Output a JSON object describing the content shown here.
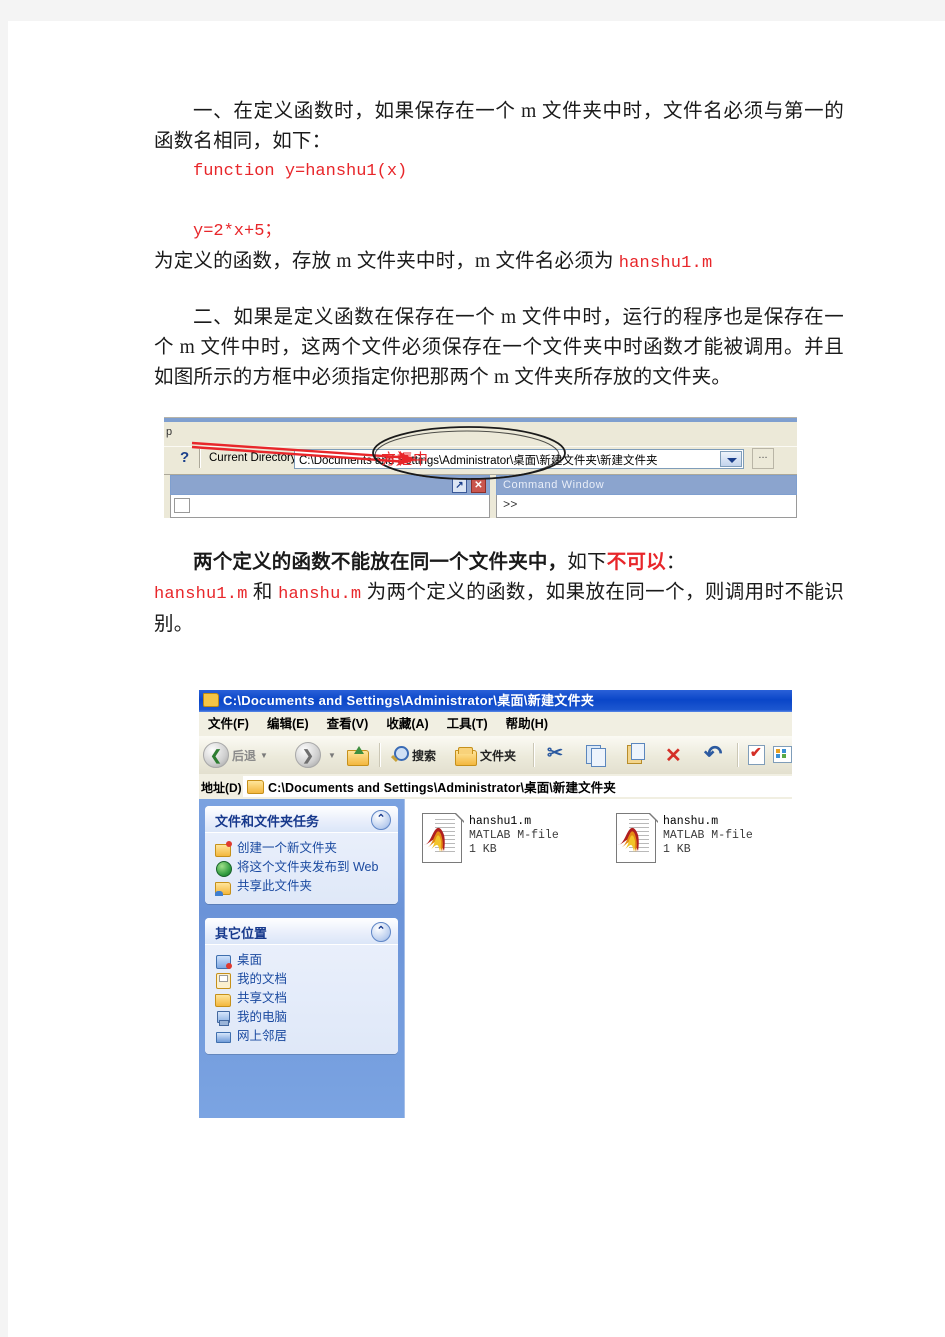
{
  "document": {
    "section1": {
      "paragraph": "一、在定义函数时，如果保存在一个 m 文件夹中时，文件名必须与第一的函数名相同，如下：",
      "code1": "function y=hanshu1(x)",
      "code2": "y=2*x+5；",
      "tail_before": "为定义的函数，存放 m 文件夹中时，m 文件名必须为 ",
      "tail_code": "hanshu1.m"
    },
    "section2": {
      "paragraph": "二、如果是定义函数在保存在一个 m 文件中时，运行的程序也是保存在一个 m 文件中时，这两个文件必须保存在一个文件夹中时函数才能被调用。并且如图所示的方框中必须指定你把那两个 m 文件夹所存放的文件夹。"
    },
    "section3": {
      "lead_bold": "两个定义的函数不能放在同一个文件夹中，",
      "lead_normal": "如下",
      "lead_red": "不可以",
      "lead_colon": "：",
      "line2_code1": "hanshu1.m",
      "line2_mid1": " 和 ",
      "line2_code2": "hanshu.m",
      "line2_rest": " 为两个定义的函数，如果放在同一个，则调用时不能识别。"
    }
  },
  "figure_matlab": {
    "help_fragment": "p",
    "help_button": "?",
    "label": "Current Directory:",
    "path_value": "C:\\Documents and Settings\\Administrator\\桌面\\新建文件夹\\新建文件夹",
    "browse_button": "...",
    "undock_button": "↗",
    "close_button": "✕",
    "command_window_title": "Command Window",
    "command_prompt": ">>",
    "annotation_label": "方框中"
  },
  "figure_explorer": {
    "title": "C:\\Documents and Settings\\Administrator\\桌面\\新建文件夹",
    "menu": [
      "文件(F)",
      "编辑(E)",
      "查看(V)",
      "收藏(A)",
      "工具(T)",
      "帮助(H)"
    ],
    "toolbar": {
      "back": "后退",
      "search": "搜索",
      "folders": "文件夹"
    },
    "address": {
      "label": "地址(D)",
      "value": "C:\\Documents and Settings\\Administrator\\桌面\\新建文件夹"
    },
    "sidebar": {
      "panel1": {
        "title": "文件和文件夹任务",
        "collapse": "⌃",
        "items": [
          "创建一个新文件夹",
          "将这个文件夹发布到 Web",
          "共享此文件夹"
        ]
      },
      "panel2": {
        "title": "其它位置",
        "collapse": "⌃",
        "items": [
          "桌面",
          "我的文档",
          "共享文档",
          "我的电脑",
          "网上邻居"
        ]
      }
    },
    "files": [
      {
        "name": "hanshu1.m",
        "type": "MATLAB M-file",
        "size": "1 KB"
      },
      {
        "name": "hanshu.m",
        "type": "MATLAB M-file",
        "size": "1 KB"
      }
    ]
  },
  "colors": {
    "red_text": "#e8262a",
    "xp_blue": "#0a46c8",
    "link_blue": "#1b4aa0"
  }
}
